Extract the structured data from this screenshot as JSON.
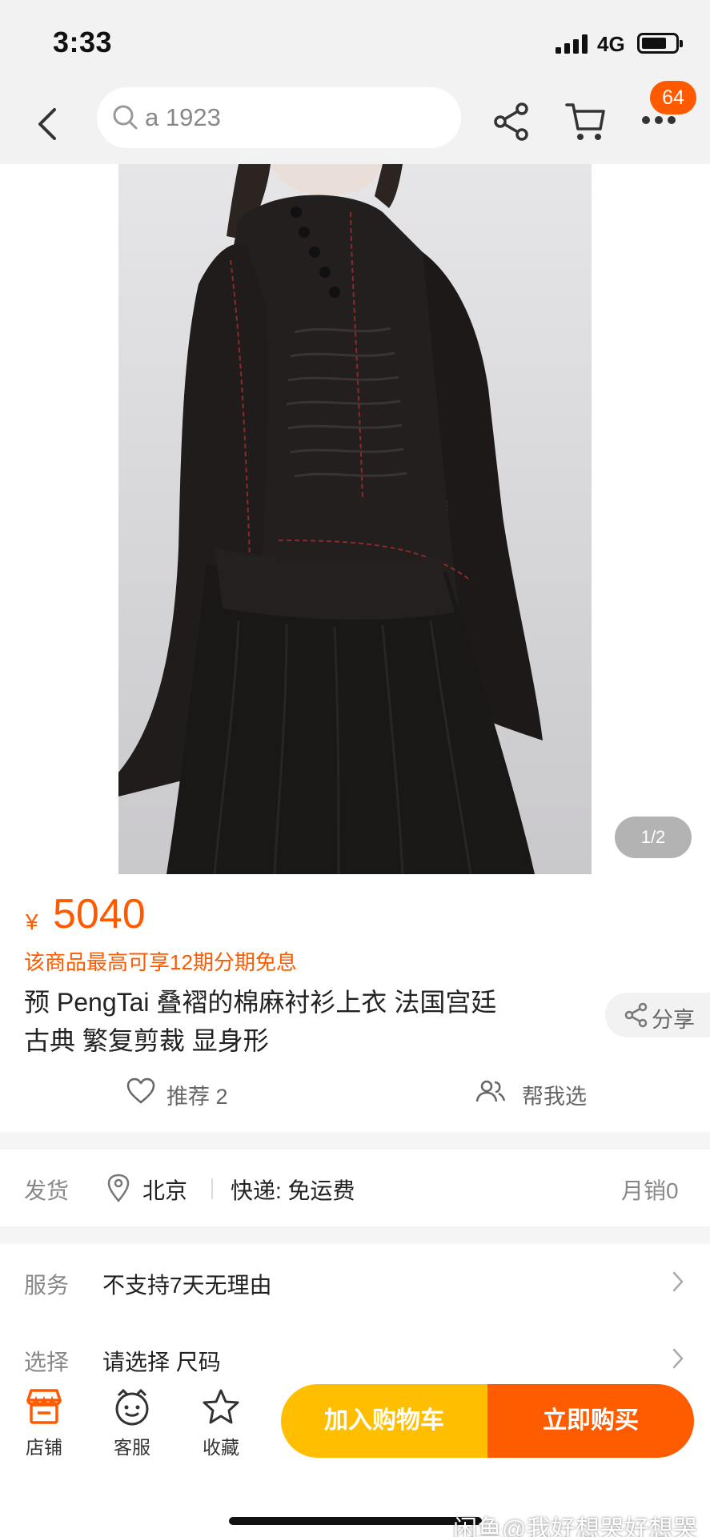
{
  "status_bar": {
    "time": "3:33",
    "network": "4G"
  },
  "nav": {
    "search_text": "a 1923",
    "message_count": "64"
  },
  "gallery": {
    "counter": "1/2"
  },
  "product": {
    "currency": "¥",
    "price": "5040",
    "installment_note": "该商品最高可享12期分期免息",
    "title_line1": "预 PengTai 叠褶的棉麻衬衫上衣 法国宫廷",
    "title_line2": "古典 繁复剪裁 显身形",
    "share_label": "分享",
    "recommend_label": "推荐 2",
    "help_pick_label": "帮我选"
  },
  "shipping": {
    "label": "发货",
    "city": "北京",
    "fee": "快递: 免运费",
    "monthly_sales": "月销0"
  },
  "options": [
    {
      "label": "服务",
      "value": "不支持7天无理由"
    },
    {
      "label": "选择",
      "value": "请选择 尺码"
    }
  ],
  "bottom_bar": {
    "tools": [
      {
        "label": "店铺",
        "icon": "store-icon"
      },
      {
        "label": "客服",
        "icon": "customer-service-icon"
      },
      {
        "label": "收藏",
        "icon": "star-icon"
      }
    ],
    "add_to_cart": "加入购物车",
    "buy_now": "立即购买"
  },
  "watermark": "闲鱼@我好想哭好想哭",
  "colors": {
    "accent": "#ff5a00",
    "cart_button": "#ffbf00",
    "buy_button": "#ff5c00"
  }
}
